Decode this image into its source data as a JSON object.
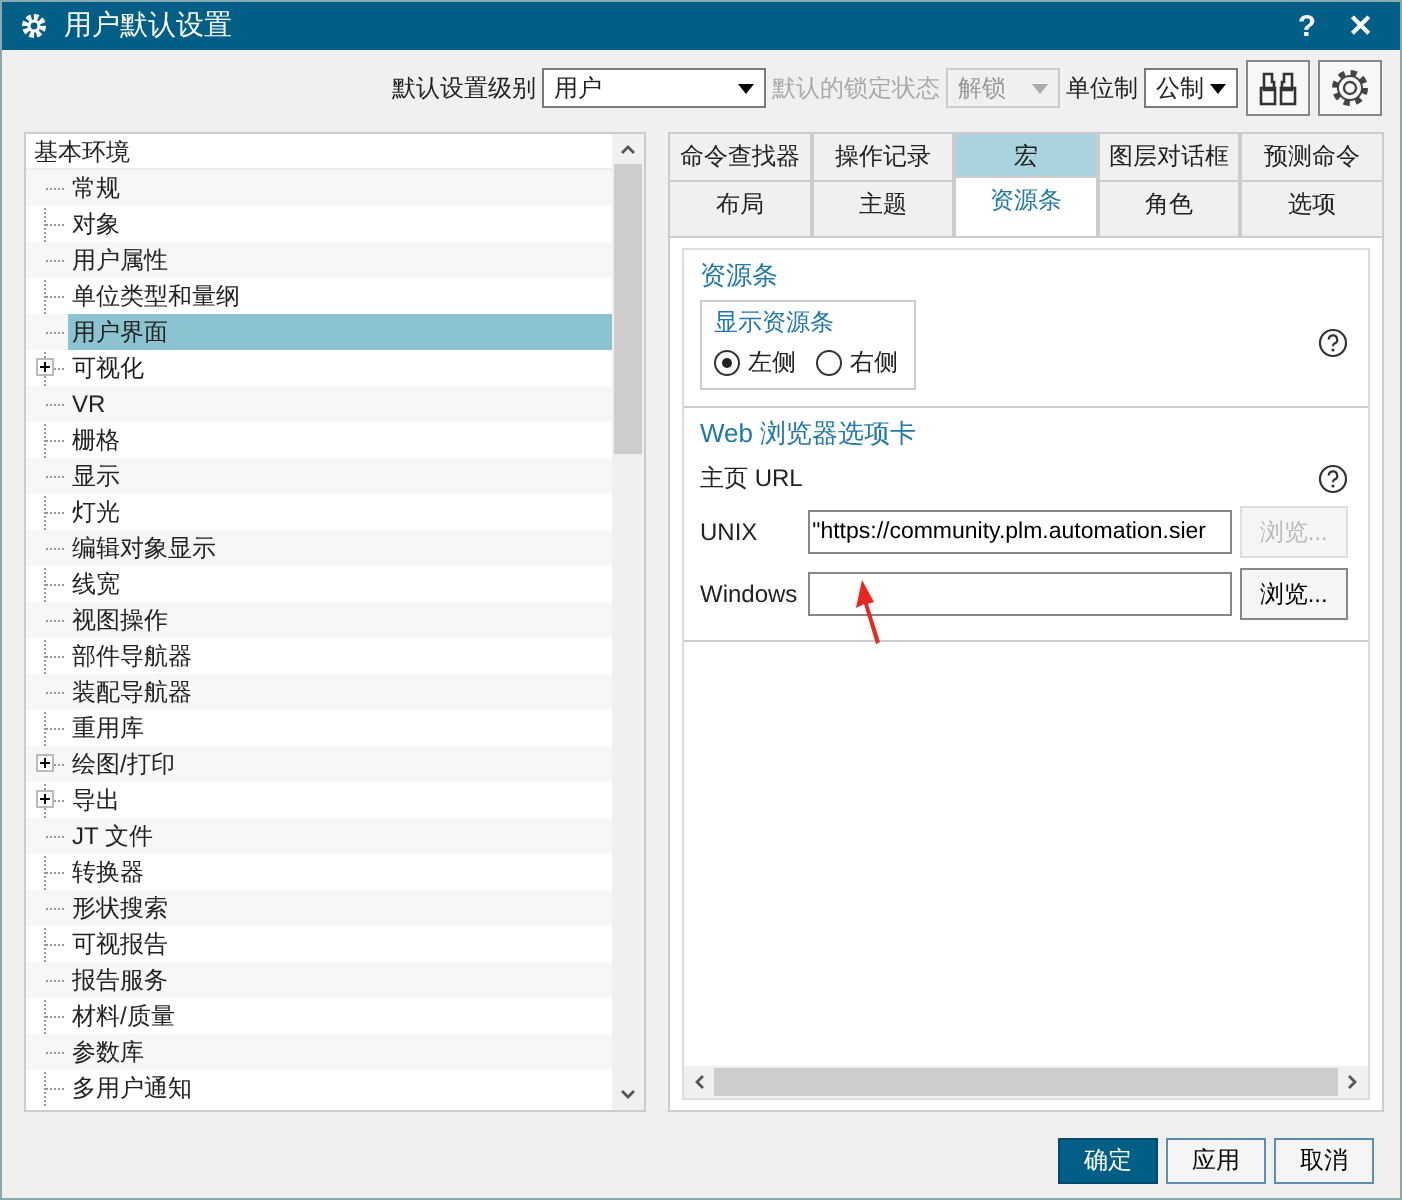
{
  "window": {
    "title": "用户默认设置",
    "help": "?",
    "close": "✕"
  },
  "toolbar": {
    "level_label": "默认设置级别",
    "level_value": "用户",
    "lock_label": "默认的锁定状态",
    "lock_value": "解锁",
    "lock_disabled": true,
    "units_label": "单位制",
    "units_value": "公制"
  },
  "tree": {
    "label": "基本环境",
    "children": [
      {
        "label": "常规",
        "kind": "leaf",
        "selected": false
      },
      {
        "label": "对象",
        "kind": "leaf",
        "selected": false
      },
      {
        "label": "用户属性",
        "kind": "leaf",
        "selected": false
      },
      {
        "label": "单位类型和量纲",
        "kind": "leaf",
        "selected": false
      },
      {
        "label": "用户界面",
        "kind": "leaf",
        "selected": true
      },
      {
        "label": "可视化",
        "kind": "folder",
        "expanded": false,
        "selected": false
      },
      {
        "label": "VR",
        "kind": "leaf",
        "selected": false
      },
      {
        "label": "栅格",
        "kind": "leaf",
        "selected": false
      },
      {
        "label": "显示",
        "kind": "leaf",
        "selected": false
      },
      {
        "label": "灯光",
        "kind": "leaf",
        "selected": false
      },
      {
        "label": "编辑对象显示",
        "kind": "leaf",
        "selected": false
      },
      {
        "label": "线宽",
        "kind": "leaf",
        "selected": false
      },
      {
        "label": "视图操作",
        "kind": "leaf",
        "selected": false
      },
      {
        "label": "部件导航器",
        "kind": "leaf",
        "selected": false
      },
      {
        "label": "装配导航器",
        "kind": "leaf",
        "selected": false
      },
      {
        "label": "重用库",
        "kind": "leaf",
        "selected": false
      },
      {
        "label": "绘图/打印",
        "kind": "folder",
        "expanded": false,
        "selected": false
      },
      {
        "label": "导出",
        "kind": "folder",
        "expanded": false,
        "selected": false
      },
      {
        "label": "JT 文件",
        "kind": "leaf",
        "selected": false
      },
      {
        "label": "转换器",
        "kind": "leaf",
        "selected": false
      },
      {
        "label": "形状搜索",
        "kind": "leaf",
        "selected": false
      },
      {
        "label": "可视报告",
        "kind": "leaf",
        "selected": false
      },
      {
        "label": "报告服务",
        "kind": "leaf",
        "selected": false
      },
      {
        "label": "材料/质量",
        "kind": "leaf",
        "selected": false
      },
      {
        "label": "参数库",
        "kind": "leaf",
        "selected": false
      },
      {
        "label": "多用户通知",
        "kind": "leaf",
        "selected": false
      }
    ]
  },
  "tab_rows": [
    [
      {
        "label": "命令查找器",
        "selected": false,
        "highlighted": false
      },
      {
        "label": "操作记录",
        "selected": false,
        "highlighted": false
      },
      {
        "label": "宏",
        "selected": false,
        "highlighted": true
      },
      {
        "label": "图层对话框",
        "selected": false,
        "highlighted": false
      },
      {
        "label": "预测命令",
        "selected": false,
        "highlighted": false
      }
    ],
    [
      {
        "label": "布局",
        "selected": false,
        "highlighted": false
      },
      {
        "label": "主题",
        "selected": false,
        "highlighted": false
      },
      {
        "label": "资源条",
        "selected": true,
        "highlighted": false
      },
      {
        "label": "角色",
        "selected": false,
        "highlighted": false
      },
      {
        "label": "选项",
        "selected": false,
        "highlighted": false
      }
    ]
  ],
  "resource_bar": {
    "title": "资源条",
    "group_title": "显示资源条",
    "options": [
      {
        "label": "左侧",
        "selected": true
      },
      {
        "label": "右侧",
        "selected": false
      }
    ]
  },
  "web_tab": {
    "title": "Web 浏览器选项卡",
    "subtitle": "主页 URL",
    "rows": [
      {
        "label": "UNIX",
        "value": "\"https://community.plm.automation.sier",
        "browse": "浏览...",
        "browse_disabled": true
      },
      {
        "label": "Windows",
        "value": "",
        "browse": "浏览...",
        "browse_disabled": false
      }
    ]
  },
  "buttons": [
    {
      "label": "确定",
      "kind": "primary"
    },
    {
      "label": "应用",
      "kind": "normal"
    },
    {
      "label": "取消",
      "kind": "normal"
    }
  ]
}
